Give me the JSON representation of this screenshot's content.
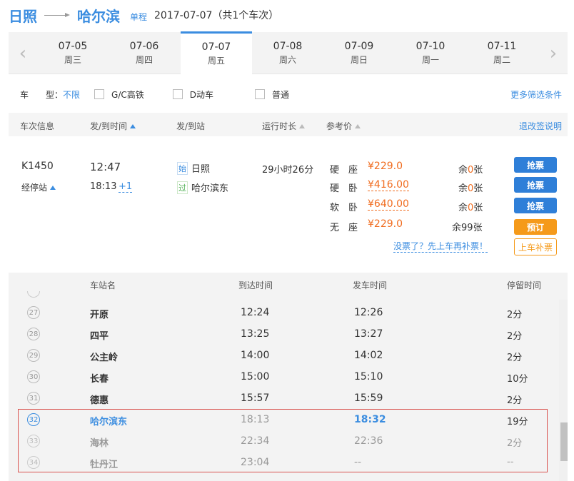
{
  "header": {
    "from": "日照",
    "to": "哈尔滨",
    "trip_type": "单程",
    "date_summary": "2017-07-07（共1个车次）"
  },
  "dates": [
    {
      "date": "07-05",
      "weekday": "周三"
    },
    {
      "date": "07-06",
      "weekday": "周四"
    },
    {
      "date": "07-07",
      "weekday": "周五"
    },
    {
      "date": "07-08",
      "weekday": "周六"
    },
    {
      "date": "07-09",
      "weekday": "周日"
    },
    {
      "date": "07-10",
      "weekday": "周一"
    },
    {
      "date": "07-11",
      "weekday": "周二"
    }
  ],
  "nav": {
    "prev": "‹",
    "next": "›"
  },
  "filters": {
    "label": "车　　型：",
    "all": "不限",
    "gc": "G/C高铁",
    "d": "D动车",
    "normal": "普通",
    "more": "更多筛选条件"
  },
  "table_header": {
    "train_info": "车次信息",
    "dep_arr_time": "发/到时间",
    "dep_arr_station": "发/到站",
    "duration": "运行时长",
    "price": "参考价",
    "refund": "退改签说明"
  },
  "train": {
    "number": "K1450",
    "stops_label": "经停站",
    "dep_time": "12:47",
    "arr_time": "18:13",
    "arr_day": "+1",
    "from_tag": "始",
    "from": "日照",
    "to_tag": "过",
    "to": "哈尔滨东",
    "duration": "29小时26分",
    "seats": [
      {
        "type": "硬　座",
        "price": "¥229.0",
        "left_pre": "余",
        "left_num": "0",
        "left_suf": "张",
        "action": "抢票"
      },
      {
        "type": "硬　卧",
        "price": "¥416.00",
        "left_pre": "余",
        "left_num": "0",
        "left_suf": "张",
        "action": "抢票"
      },
      {
        "type": "软　卧",
        "price": "¥640.00",
        "left_pre": "余",
        "left_num": "0",
        "left_suf": "张",
        "action": "抢票"
      },
      {
        "type": "无　座",
        "price": "¥229.0",
        "left_pre": "余",
        "left_num": "99",
        "left_suf": "张",
        "action": "预订"
      }
    ],
    "no_ticket_link": "没票了？先上车再补票！",
    "onboard_button": "上车补票"
  },
  "stops_header": {
    "name": "车站名",
    "arrive": "到达时间",
    "depart": "发车时间",
    "stay": "停留时间"
  },
  "stops": [
    {
      "no": "27",
      "name": "开原",
      "arrive": "12:24",
      "depart": "12:26",
      "stay": "2分"
    },
    {
      "no": "28",
      "name": "四平",
      "arrive": "13:25",
      "depart": "13:27",
      "stay": "2分"
    },
    {
      "no": "29",
      "name": "公主岭",
      "arrive": "14:00",
      "depart": "14:02",
      "stay": "2分"
    },
    {
      "no": "30",
      "name": "长春",
      "arrive": "15:00",
      "depart": "15:10",
      "stay": "10分"
    },
    {
      "no": "31",
      "name": "德惠",
      "arrive": "15:57",
      "depart": "15:59",
      "stay": "2分"
    },
    {
      "no": "32",
      "name": "哈尔滨东",
      "arrive": "18:13",
      "depart": "18:32",
      "stay": "19分"
    },
    {
      "no": "33",
      "name": "海林",
      "arrive": "22:34",
      "depart": "22:36",
      "stay": "2分"
    },
    {
      "no": "34",
      "name": "牡丹江",
      "arrive": "23:04",
      "depart": "--",
      "stay": "--"
    }
  ],
  "colors": {
    "accent": "#3b8de0",
    "price": "#f06c1f",
    "book": "#f59a1a",
    "highlight_box": "#d9534f"
  }
}
